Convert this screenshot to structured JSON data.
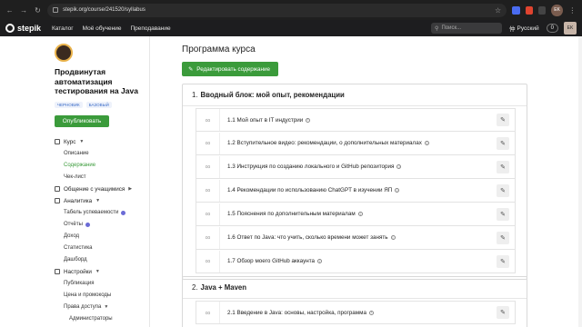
{
  "browser": {
    "url": "stepik.org/course/241520/syllabus",
    "profile_initials": "EK"
  },
  "topnav": {
    "logo": "stepik",
    "links": [
      "Каталог",
      "Моё обучение",
      "Преподавание"
    ],
    "search_placeholder": "Поиск...",
    "language": "Русский",
    "counter": "0",
    "user_initials": "EK"
  },
  "sidebar": {
    "course_title": "Продвинутая автоматизация тестирования на Java",
    "tags": [
      "ЧЕРНОВИК",
      "БАЗОВЫЙ"
    ],
    "publish_label": "Опубликовать",
    "sections": [
      {
        "label": "Курс",
        "items": [
          {
            "label": "Описание",
            "active": false
          },
          {
            "label": "Содержание",
            "active": true
          },
          {
            "label": "Чек-лист",
            "active": false
          }
        ]
      },
      {
        "label": "Общение с учащимися",
        "items": []
      },
      {
        "label": "Аналитика",
        "items": [
          {
            "label": "Табель успеваемости",
            "active": false
          },
          {
            "label": "Отчёты",
            "active": false
          },
          {
            "label": "Доход",
            "active": false
          },
          {
            "label": "Статистика",
            "active": false
          },
          {
            "label": "Дашборд",
            "active": false
          }
        ]
      },
      {
        "label": "Настройки",
        "items": [
          {
            "label": "Публикация",
            "active": false
          },
          {
            "label": "Цена и промокоды",
            "active": false
          },
          {
            "label": "Права доступа",
            "active": false
          },
          {
            "label": "Администраторы",
            "active": false
          }
        ]
      }
    ]
  },
  "main": {
    "title": "Программа курса",
    "edit_label": "Редактировать содержание",
    "modules": [
      {
        "num": "1.",
        "title": "Вводный блок: мой опыт, рекомендации",
        "lessons": [
          "1.1 Мой опыт в IT индустрии",
          "1.2 Вступительное видео: рекомендации, о дополнительных материалах",
          "1.3 Инструкция по созданию локального и GitHub репозитория",
          "1.4 Рекомендации по использованию ChatGPT в изучении ЯП",
          "1.5 Пояснения по дополнительным материалам",
          "1.6 Ответ по Java: что учить, сколько времени может занять",
          "1.7 Обзор моего GitHub аккаунта"
        ]
      },
      {
        "num": "2.",
        "title": "Java + Maven",
        "lessons": [
          "2.1 Введение в Java: основы, настройка, программа"
        ]
      }
    ]
  }
}
